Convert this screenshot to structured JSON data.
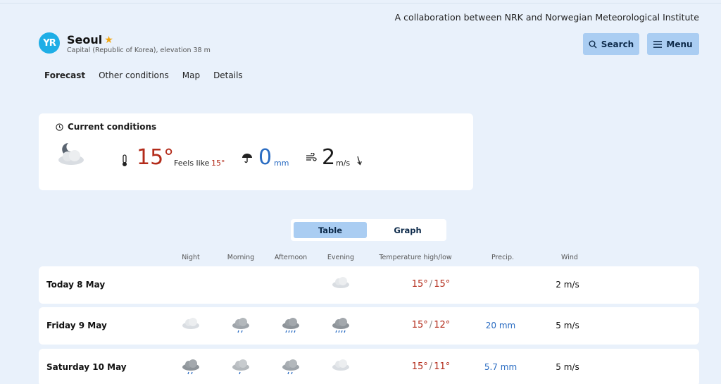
{
  "header": {
    "collab_text": "A collaboration between NRK and Norwegian Meteorological Institute",
    "logo_text": "YR",
    "location_name": "Seoul",
    "location_subtitle": "Capital (Republic of Korea), elevation 38 m",
    "search_label": "Search",
    "menu_label": "Menu"
  },
  "nav": {
    "tabs": [
      {
        "label": "Forecast",
        "active": true
      },
      {
        "label": "Other conditions"
      },
      {
        "label": "Map"
      },
      {
        "label": "Details"
      }
    ]
  },
  "current": {
    "title": "Current conditions",
    "weather_icon": "partly-cloudy-night-icon",
    "temperature": "15°",
    "feels_like_label": "Feels like",
    "feels_like_value": "15°",
    "precip_value": "0",
    "precip_unit": "mm",
    "wind_value": "2",
    "wind_unit": "m/s"
  },
  "view_toggle": {
    "table_label": "Table",
    "graph_label": "Graph",
    "selected": "Table"
  },
  "table": {
    "headers": [
      "Night",
      "Morning",
      "Afternoon",
      "Evening",
      "Temperature high/low",
      "Precip.",
      "Wind"
    ],
    "rows": [
      {
        "date": "Today 8 May",
        "icons": [
          "",
          "",
          "",
          "cloud-icon"
        ],
        "temp_high": "15°",
        "temp_low": "15°",
        "precip": "",
        "wind": "2 m/s"
      },
      {
        "date": "Friday 9 May",
        "icons": [
          "cloud-icon",
          "light-rain-icon",
          "rain-icon",
          "rain-icon"
        ],
        "temp_high": "15°",
        "temp_low": "12°",
        "precip": "20 mm",
        "wind": "5 m/s"
      },
      {
        "date": "Saturday 10 May",
        "icons": [
          "rain-icon",
          "light-rain-icon",
          "rain-icon",
          "cloud-icon"
        ],
        "temp_high": "15°",
        "temp_low": "11°",
        "precip": "5.7 mm",
        "wind": "5 m/s"
      }
    ]
  },
  "colors": {
    "background": "#e9f1fb",
    "accent_button": "#aacdf2",
    "temperature": "#b32b1a",
    "precipitation": "#2a6cc2",
    "logo": "#1eaee6"
  }
}
